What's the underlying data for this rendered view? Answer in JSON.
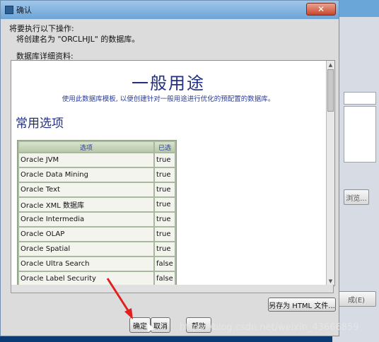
{
  "background": {
    "browse_button": "浏览...",
    "right_button": "成(E)"
  },
  "dialog": {
    "title": "确认",
    "close_icon": "close-icon",
    "intro_line1": "将要执行以下操作:",
    "intro_line2": "将创建名为 \"ORCLHJL\" 的数据库。",
    "details_label": "数据库详细资料:",
    "big_title": "一般用途",
    "subtitle": "使用此数据库模板, 以便创建针对一般用途进行优化的预配置的数据库。",
    "section_title": "常用选项",
    "table": {
      "headers": [
        "选项",
        "已选"
      ],
      "rows": [
        [
          "Oracle JVM",
          "true"
        ],
        [
          "Oracle Data Mining",
          "true"
        ],
        [
          "Oracle Text",
          "true"
        ],
        [
          "Oracle XML 数据库",
          "true"
        ],
        [
          "Oracle Intermedia",
          "true"
        ],
        [
          "Oracle OLAP",
          "true"
        ],
        [
          "Oracle Spatial",
          "true"
        ],
        [
          "Oracle Ultra Search",
          "false"
        ],
        [
          "Oracle Label Security",
          "false"
        ]
      ]
    },
    "save_html_button": "另存为 HTML 文件...",
    "ok_button": "确定",
    "cancel_button": "取消",
    "help_button": "帮助"
  },
  "watermark": "https://blog.csdn.net/weixin_43666859"
}
